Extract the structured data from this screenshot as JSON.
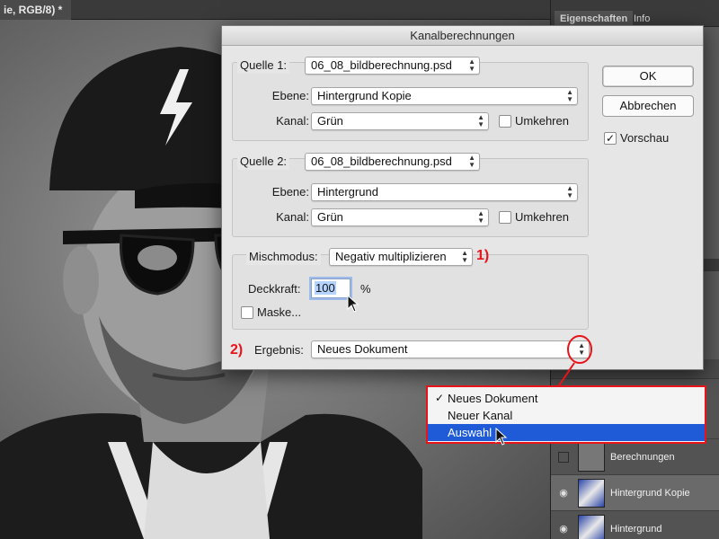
{
  "document": {
    "tab_title": "ie, RGB/8) *"
  },
  "panel": {
    "tabs": [
      "Eigenschaften",
      "Info"
    ],
    "layers": [
      {
        "name": "Berechnungen",
        "visible": false,
        "selected": false
      },
      {
        "name": "Hintergrund Kopie",
        "visible": true,
        "selected": true
      },
      {
        "name": "Hintergrund",
        "visible": true,
        "selected": false
      }
    ]
  },
  "dialog": {
    "title": "Kanalberechnungen",
    "source1": {
      "label": "Quelle 1:",
      "file": "06_08_bildberechnung.psd",
      "layer_label": "Ebene:",
      "layer": "Hintergrund Kopie",
      "channel_label": "Kanal:",
      "channel": "Grün",
      "invert_label": "Umkehren",
      "invert": false
    },
    "source2": {
      "label": "Quelle 2:",
      "file": "06_08_bildberechnung.psd",
      "layer_label": "Ebene:",
      "layer": "Hintergrund",
      "channel_label": "Kanal:",
      "channel": "Grün",
      "invert_label": "Umkehren",
      "invert": false
    },
    "blend": {
      "mode_label": "Mischmodus:",
      "mode": "Negativ multiplizieren",
      "opacity_label": "Deckkraft:",
      "opacity": "100",
      "opacity_unit": "%",
      "mask_label": "Maske...",
      "mask": false
    },
    "result": {
      "label": "Ergebnis:",
      "value": "Neues Dokument"
    },
    "buttons": {
      "ok": "OK",
      "cancel": "Abbrechen",
      "preview_label": "Vorschau",
      "preview": true
    }
  },
  "annotations": {
    "one": "1)",
    "two": "2)"
  },
  "dropdown": {
    "items": [
      {
        "label": "Neues Dokument",
        "checked": true,
        "highlighted": false
      },
      {
        "label": "Neuer Kanal",
        "checked": false,
        "highlighted": false
      },
      {
        "label": "Auswahl",
        "checked": false,
        "highlighted": true
      }
    ]
  },
  "colors": {
    "annotation_red": "#e8141a",
    "highlight_blue": "#1f5bd6"
  }
}
